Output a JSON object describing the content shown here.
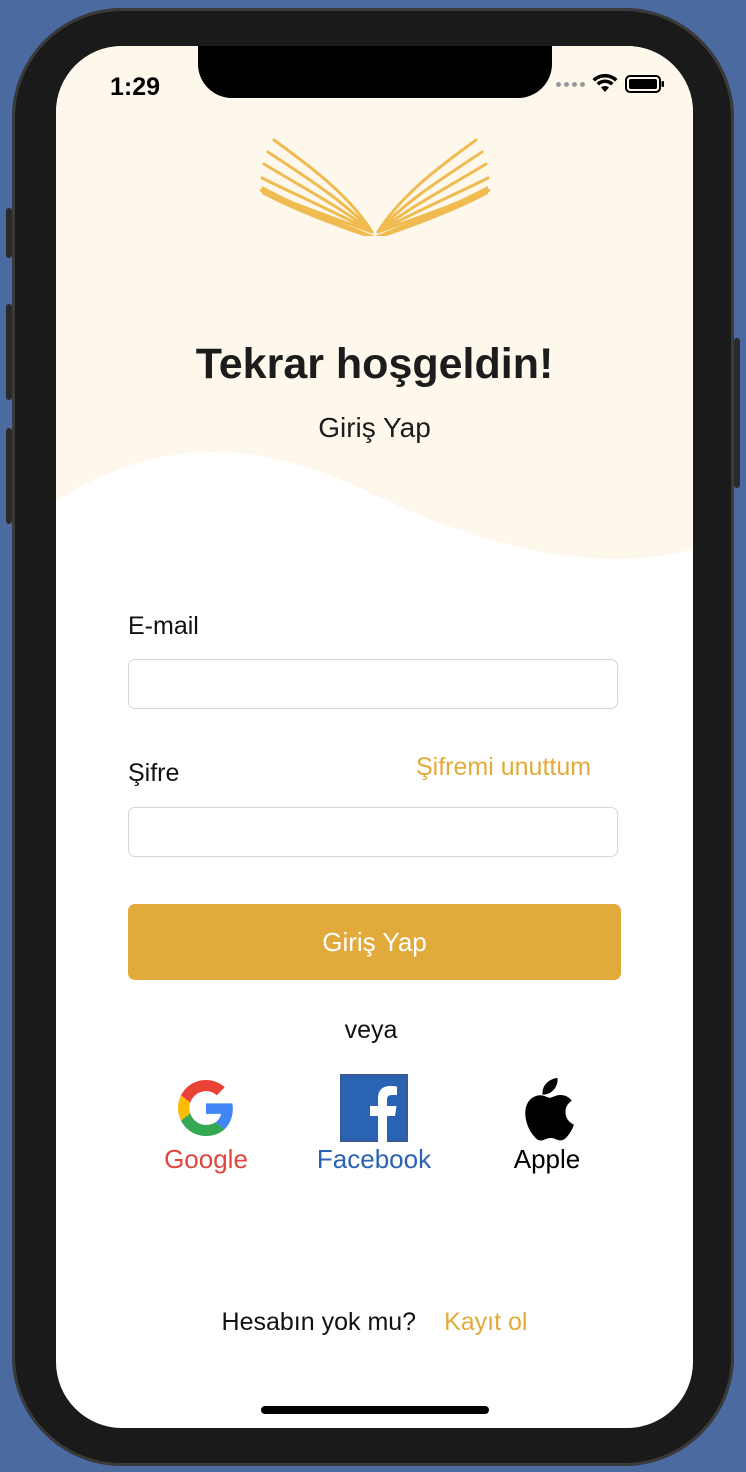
{
  "status_bar": {
    "time": "1:29"
  },
  "header": {
    "title": "Tekrar hoşgeldin!",
    "subtitle": "Giriş Yap"
  },
  "form": {
    "email_label": "E-mail",
    "email_value": "",
    "password_label": "Şifre",
    "password_value": "",
    "forgot_password": "Şifremi unuttum",
    "login_button": "Giriş Yap"
  },
  "divider_text": "veya",
  "social": [
    {
      "label": "Google",
      "icon": "google-icon",
      "color": "#e0463c"
    },
    {
      "label": "Facebook",
      "icon": "facebook-icon",
      "color": "#2a62b4"
    },
    {
      "label": "Apple",
      "icon": "apple-icon",
      "color": "#000000"
    }
  ],
  "footer": {
    "question": "Hesabın yok mu?",
    "signup_link": "Kayıt ol"
  },
  "colors": {
    "accent": "#e1aa3a",
    "header_bg": "#fef8ec"
  }
}
